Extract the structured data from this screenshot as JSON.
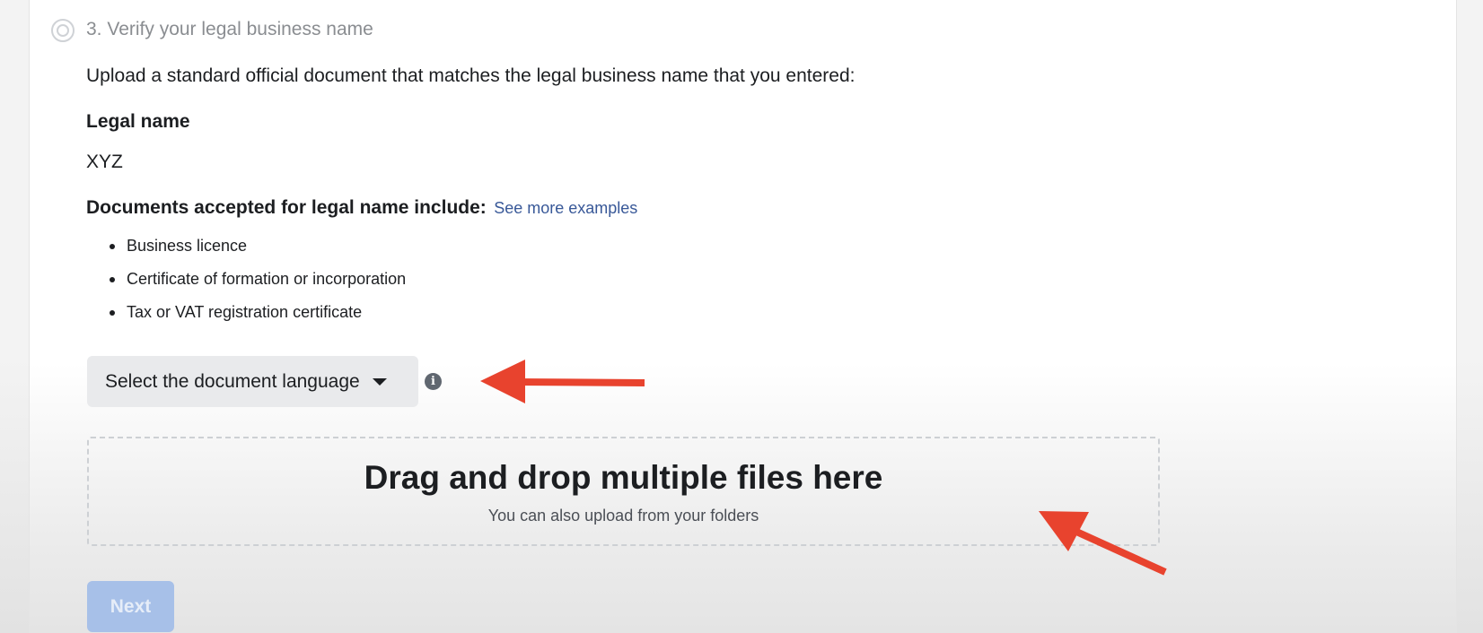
{
  "step": {
    "title": "3. Verify your legal business name",
    "instruction": "Upload a standard official document that matches the legal business name that you entered:"
  },
  "legal_name": {
    "label": "Legal name",
    "value": "XYZ"
  },
  "documents": {
    "label": "Documents accepted for legal name include:",
    "link": "See more examples",
    "items": [
      "Business licence",
      "Certificate of formation or incorporation",
      "Tax or VAT registration certificate"
    ]
  },
  "language_select": {
    "label": "Select the document language"
  },
  "dropzone": {
    "title": "Drag and drop multiple files here",
    "subtitle": "You can also upload from your folders"
  },
  "next_button": {
    "label": "Next"
  },
  "icons": {
    "step": "step-radio-icon",
    "caret": "caret-down-icon",
    "info": "info-icon"
  },
  "colors": {
    "link": "#385898",
    "arrow": "#e8432e",
    "button_disabled": "#a7c0e8"
  }
}
